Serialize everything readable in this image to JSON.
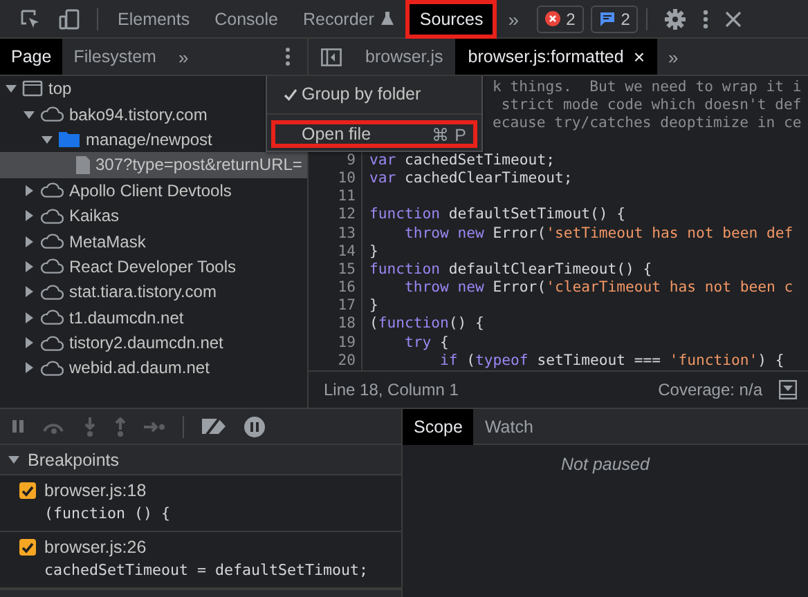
{
  "toolbar": {
    "tabs": [
      {
        "label": "Elements",
        "selected": false,
        "highlighted": false,
        "kind": "plain"
      },
      {
        "label": "Console",
        "selected": false,
        "highlighted": false,
        "kind": "plain"
      },
      {
        "label": "Recorder",
        "selected": false,
        "highlighted": false,
        "kind": "experimental"
      },
      {
        "label": "Sources",
        "selected": true,
        "highlighted": true,
        "kind": "plain"
      }
    ],
    "more": "»",
    "error_count": "2",
    "message_count": "2"
  },
  "navigator": {
    "tabs": [
      {
        "label": "Page",
        "selected": true
      },
      {
        "label": "Filesystem",
        "selected": false
      }
    ],
    "more": "»",
    "tree": [
      {
        "label": "top",
        "kind": "frame",
        "expanded": true,
        "selected": false,
        "children": [
          {
            "label": "bako94.tistory.com",
            "kind": "domain",
            "expanded": true,
            "selected": false,
            "children": [
              {
                "label": "manage/newpost",
                "kind": "folder",
                "expanded": true,
                "selected": false,
                "children": [
                  {
                    "label": "307?type=post&returnURL=",
                    "kind": "file",
                    "selected": true
                  }
                ]
              }
            ]
          },
          {
            "label": "Apollo Client Devtools",
            "kind": "domain",
            "expanded": false,
            "selected": false
          },
          {
            "label": "Kaikas",
            "kind": "domain",
            "expanded": false,
            "selected": false
          },
          {
            "label": "MetaMask",
            "kind": "domain",
            "expanded": false,
            "selected": false
          },
          {
            "label": "React Developer Tools",
            "kind": "domain",
            "expanded": false,
            "selected": false
          },
          {
            "label": "stat.tiara.tistory.com",
            "kind": "domain",
            "expanded": false,
            "selected": false
          },
          {
            "label": "t1.daumcdn.net",
            "kind": "domain",
            "expanded": false,
            "selected": false
          },
          {
            "label": "tistory2.daumcdn.net",
            "kind": "domain",
            "expanded": false,
            "selected": false
          },
          {
            "label": "webid.ad.daum.net",
            "kind": "domain",
            "expanded": false,
            "selected": false
          }
        ]
      }
    ]
  },
  "context_menu": {
    "items": [
      {
        "label": "Group by folder",
        "checked": true,
        "highlighted": false
      },
      {
        "label": "Open file",
        "shortcut": "⌘ P",
        "checked": false,
        "highlighted": true
      }
    ]
  },
  "editor": {
    "tabs": [
      {
        "label": "browser.js",
        "selected": false,
        "closable": false
      },
      {
        "label": "browser.js:formatted",
        "selected": true,
        "closable": true
      }
    ],
    "more": "»",
    "close": "×",
    "lines": [
      {
        "tokens": [
          {
            "kind": "comment",
            "text": "k things.  But we need to wrap it i"
          }
        ]
      },
      {
        "tokens": [
          {
            "kind": "comment",
            "text": " strict mode code which doesn't def"
          }
        ]
      },
      {
        "tokens": [
          {
            "kind": "comment",
            "text": "ecause try/catches deoptimize in ce"
          }
        ]
      },
      {
        "number": "9",
        "tokens": [
          {
            "kind": "keyword",
            "text": "var"
          },
          {
            "kind": "plain",
            "text": " cachedSetTimeout;"
          }
        ]
      },
      {
        "number": "10",
        "tokens": [
          {
            "kind": "keyword",
            "text": "var"
          },
          {
            "kind": "plain",
            "text": " cachedClearTimeout;"
          }
        ]
      },
      {
        "number": "11"
      },
      {
        "number": "12",
        "tokens": [
          {
            "kind": "keyword",
            "text": "function"
          },
          {
            "kind": "plain",
            "text": " defaultSetTimout() {"
          }
        ]
      },
      {
        "number": "13",
        "tokens": [
          {
            "kind": "keyword",
            "text": "    throw new"
          },
          {
            "kind": "plain",
            "text": " Error("
          },
          {
            "kind": "string",
            "text": "'setTimeout has not been def"
          }
        ]
      },
      {
        "number": "14",
        "tokens": [
          {
            "kind": "plain",
            "text": "}"
          }
        ]
      },
      {
        "number": "15",
        "tokens": [
          {
            "kind": "keyword",
            "text": "function"
          },
          {
            "kind": "plain",
            "text": " defaultClearTimeout() {"
          }
        ]
      },
      {
        "number": "16",
        "tokens": [
          {
            "kind": "keyword",
            "text": "    throw new"
          },
          {
            "kind": "plain",
            "text": " Error("
          },
          {
            "kind": "string",
            "text": "'clearTimeout has not been c"
          }
        ]
      },
      {
        "number": "17",
        "tokens": [
          {
            "kind": "plain",
            "text": "}"
          }
        ]
      },
      {
        "number": "18",
        "tokens": [
          {
            "kind": "plain",
            "text": "("
          },
          {
            "kind": "keyword",
            "text": "function"
          },
          {
            "kind": "plain",
            "text": "() {"
          }
        ]
      },
      {
        "number": "19",
        "tokens": [
          {
            "kind": "keyword",
            "text": "    try"
          },
          {
            "kind": "plain",
            "text": " {"
          }
        ]
      },
      {
        "number": "20",
        "tokens": [
          {
            "kind": "keyword",
            "text": "        if"
          },
          {
            "kind": "plain",
            "text": " ("
          },
          {
            "kind": "keyword",
            "text": "typeof"
          },
          {
            "kind": "plain",
            "text": " setTimeout === "
          },
          {
            "kind": "string",
            "text": "'function'"
          },
          {
            "kind": "plain",
            "text": ") {"
          }
        ]
      }
    ],
    "status": {
      "position": "Line 18, Column 1",
      "coverage": "Coverage: n/a"
    }
  },
  "debugger": {
    "breakpoints": {
      "title": "Breakpoints",
      "expanded": true,
      "items": [
        {
          "file": "browser.js:18",
          "code": "(function () {",
          "checked": true
        },
        {
          "file": "browser.js:26",
          "code": "cachedSetTimeout = defaultSetTimout;",
          "checked": true
        }
      ]
    }
  },
  "sidebar": {
    "tabs": [
      {
        "label": "Scope",
        "selected": true
      },
      {
        "label": "Watch",
        "selected": false
      }
    ],
    "message": "Not paused"
  }
}
